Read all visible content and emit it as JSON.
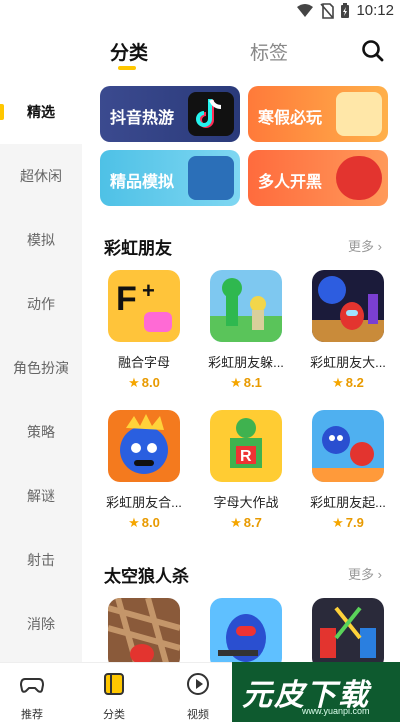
{
  "status_bar": {
    "time": "10:12"
  },
  "header": {
    "tab_category": "分类",
    "tab_tags": "标签"
  },
  "sidebar": {
    "items": [
      {
        "label": "精选"
      },
      {
        "label": "超休闲"
      },
      {
        "label": "模拟"
      },
      {
        "label": "动作"
      },
      {
        "label": "角色扮演"
      },
      {
        "label": "策略"
      },
      {
        "label": "解谜"
      },
      {
        "label": "射击"
      },
      {
        "label": "消除"
      }
    ]
  },
  "banners": [
    {
      "label": "抖音热游"
    },
    {
      "label": "寒假必玩"
    },
    {
      "label": "精品模拟"
    },
    {
      "label": "多人开黑"
    }
  ],
  "sections": [
    {
      "title": "彩虹朋友",
      "more": "更多",
      "apps": [
        {
          "name": "融合字母",
          "rating": "8.0"
        },
        {
          "name": "彩虹朋友躲...",
          "rating": "8.1"
        },
        {
          "name": "彩虹朋友大...",
          "rating": "8.2"
        },
        {
          "name": "彩虹朋友合...",
          "rating": "8.0"
        },
        {
          "name": "字母大作战",
          "rating": "8.7"
        },
        {
          "name": "彩虹朋友起...",
          "rating": "7.9"
        }
      ]
    },
    {
      "title": "太空狼人杀",
      "more": "更多"
    }
  ],
  "bottom_nav": [
    {
      "label": "推荐",
      "icon": "gamepad-icon"
    },
    {
      "label": "分类",
      "icon": "category-icon"
    },
    {
      "label": "视频",
      "icon": "play-icon"
    }
  ],
  "watermark": {
    "text": "元皮下载",
    "url": "www.yuanpi.com"
  },
  "colors": {
    "accent": "#FFC700",
    "rating": "#E89A00"
  }
}
